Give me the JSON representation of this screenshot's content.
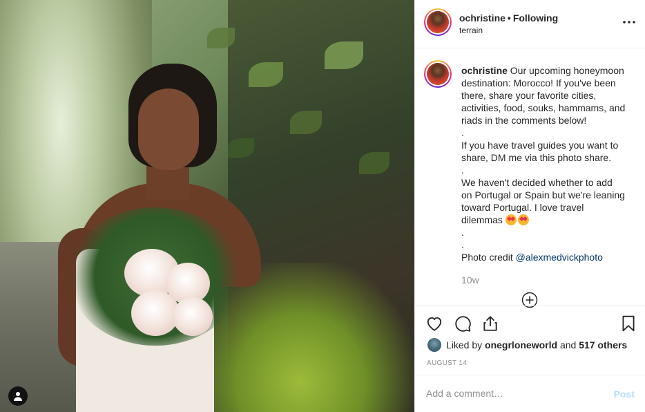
{
  "post": {
    "username": "ochristine",
    "separator": "•",
    "follow_status": "Following",
    "location": "terrain"
  },
  "caption": {
    "username": "ochristine",
    "lines": [
      "Our upcoming honeymoon",
      "destination: Morocco! If you've been",
      "there, share your favorite cities,",
      "activities, food, souks, hammams, and",
      "riads in the comments below!",
      ".",
      "If you have travel guides you want to",
      "share, DM me via this photo share.",
      ".",
      "We haven't decided whether to add",
      "on Portugal or Spain but we're leaning",
      "toward Portugal. I love travel",
      "dilemmas",
      ".",
      ".",
      "Photo credit"
    ],
    "mention": "@alexmedvickphoto",
    "time_ago": "10w"
  },
  "likes": {
    "prefix": "Liked by",
    "liker": "onegrloneworld",
    "joiner": "and",
    "others": "517 others"
  },
  "date": "AUGUST 14",
  "comment": {
    "placeholder": "Add a comment…",
    "post_label": "Post"
  },
  "icons": [
    "user-tag-icon",
    "more-options-icon",
    "load-more-icon",
    "heart-icon",
    "comment-icon",
    "share-icon",
    "bookmark-icon",
    "heart-eyes-emoji"
  ],
  "colors": {
    "text": "#262626",
    "muted": "#8e8e8e",
    "mention": "#003569",
    "post_disabled": "#b2dffc",
    "divider": "#efefef"
  }
}
